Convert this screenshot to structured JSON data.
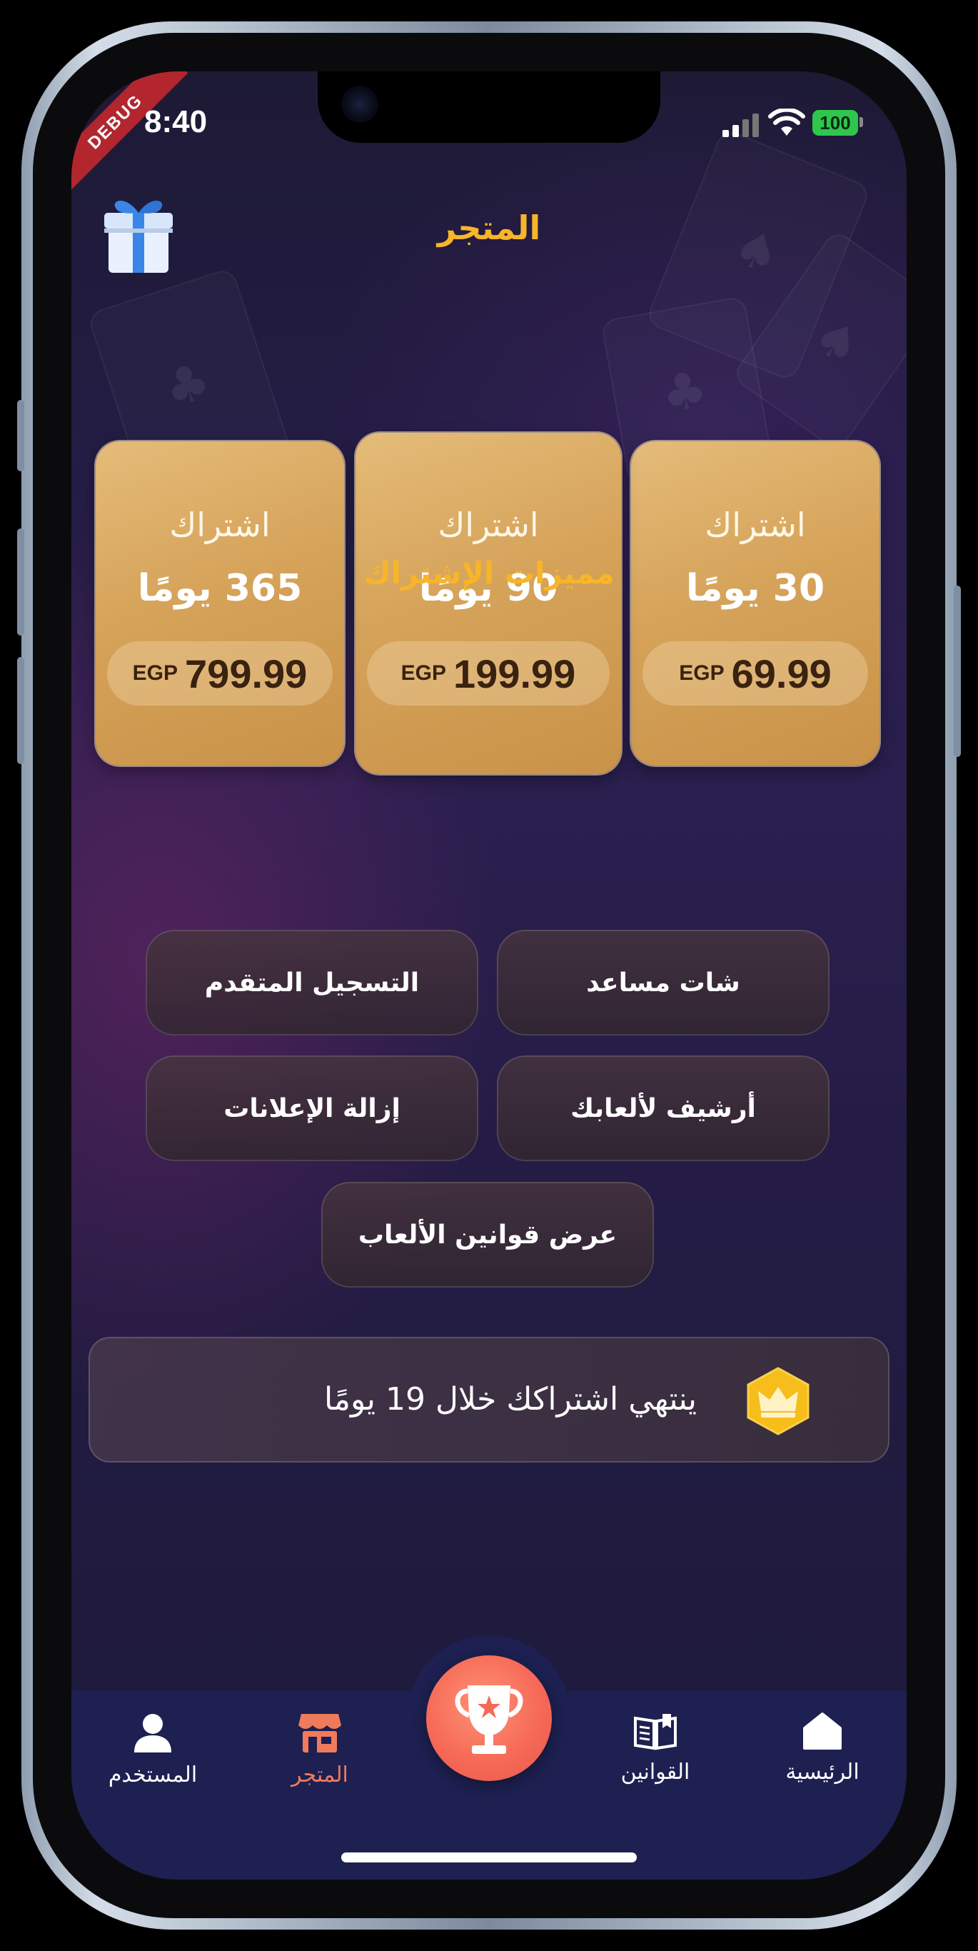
{
  "status_bar": {
    "time": "8:40",
    "debug_label": "DEBUG",
    "battery": "100"
  },
  "header": {
    "title": "المتجر"
  },
  "plans": [
    {
      "label": "اشتراك",
      "days": "30 يومًا",
      "currency": "EGP",
      "price": "69.99"
    },
    {
      "label": "اشتراك",
      "days": "90 يومًا",
      "currency": "EGP",
      "price": "199.99"
    },
    {
      "label": "اشتراك",
      "days": "365 يومًا",
      "currency": "EGP",
      "price": "799.99"
    }
  ],
  "features": {
    "title": "مميزات الإشتراك",
    "items": [
      "شات مساعد",
      "التسجيل المتقدم",
      "أرشيف لألعابك",
      "إزالة الإعلانات",
      "عرض قوانين الألعاب"
    ]
  },
  "subscription": {
    "remaining_text": "ينتهي اشتراكك خلال  19  يومًا"
  },
  "nav": {
    "items": [
      {
        "label": "الرئيسية",
        "icon": "home-icon"
      },
      {
        "label": "القوانين",
        "icon": "rules-book-icon"
      },
      {
        "label": "",
        "icon": "trophy-icon"
      },
      {
        "label": "المتجر",
        "icon": "store-icon",
        "active": true
      },
      {
        "label": "المستخدم",
        "icon": "user-icon"
      }
    ],
    "active_color": "#f07a5c"
  },
  "colors": {
    "accent": "#f7b52a",
    "nav_bg": "#1d2050",
    "card_gold": "#d6a35a",
    "trophy": "#f66a57"
  }
}
